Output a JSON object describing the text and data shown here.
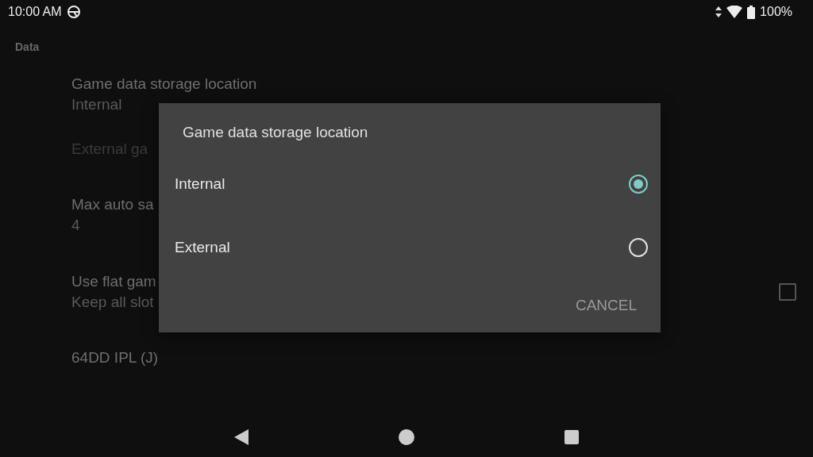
{
  "status_bar": {
    "time": "10:00 AM",
    "battery": "100%"
  },
  "section_header": "Data",
  "settings": [
    {
      "kind": "text",
      "title": "Game data storage location",
      "summary": "Internal",
      "disabled": false
    },
    {
      "kind": "text",
      "title": "External ga",
      "disabled": true
    },
    {
      "kind": "text",
      "title": "Max auto sa",
      "summary": "4",
      "disabled": false
    },
    {
      "kind": "checkbox",
      "title": "Use flat gam",
      "summary": "Keep all slot",
      "checked": false,
      "disabled": false
    },
    {
      "kind": "text",
      "title": "64DD IPL (J)",
      "disabled": false
    }
  ],
  "dialog": {
    "title": "Game data storage location",
    "options": [
      {
        "label": "Internal",
        "selected": true
      },
      {
        "label": "External",
        "selected": false
      }
    ],
    "buttons": [
      "CANCEL"
    ]
  }
}
